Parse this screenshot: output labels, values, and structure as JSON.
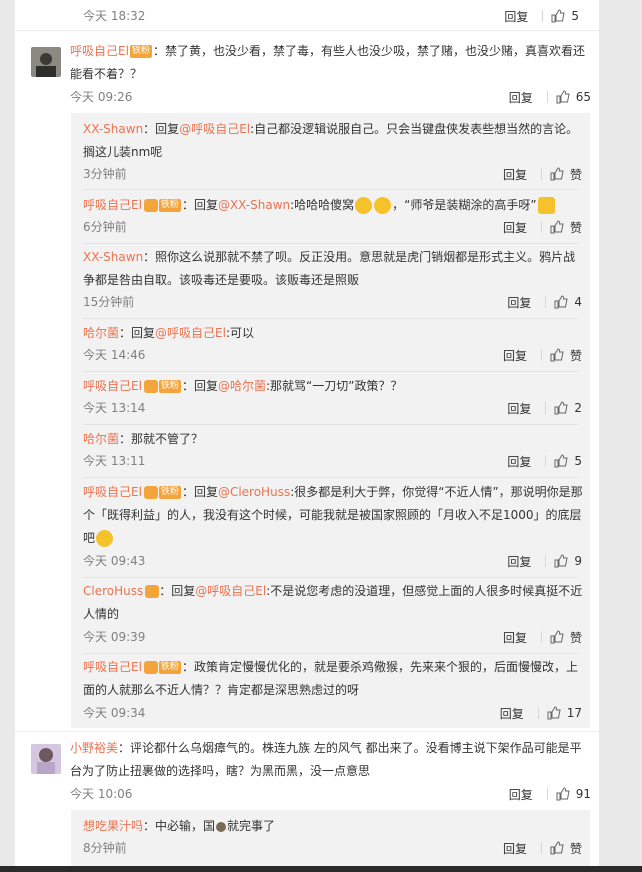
{
  "labels": {
    "reply": "回复",
    "like": "赞",
    "fan_badge": "铁粉"
  },
  "top_row": {
    "time": "今天 18:32",
    "likes": "5"
  },
  "comment1": {
    "user": "呼吸自己El",
    "text": "：禁了黄，也没少看，禁了毒，有些人也没少吸，禁了赌，也没少赌，真喜欢看还能看不着？？",
    "time": "今天 09:26",
    "likes": "65"
  },
  "replies": [
    {
      "user": "XX-Shawn",
      "pre": "：回复",
      "mention": "@呼吸自己El",
      "text": ":自己都没逻辑说服自己。只会当键盘侠发表些想当然的言论。搁这儿装nm呢",
      "time": "3分钟前"
    },
    {
      "user": "呼吸自己El",
      "pre": "：回复",
      "mention": "@XX-Shawn",
      "text": ":哈哈哈傻窝",
      "tail": "，“师爷是装糊涂的高手呀”",
      "time": "6分钟前"
    },
    {
      "user": "XX-Shawn",
      "text": "：照你这么说那就不禁了呗。反正没用。意思就是虎门销烟都是形式主义。鸦片战争都是咎由自取。该吸毒还是要吸。该贩毒还是照贩",
      "time": "15分钟前",
      "likes": "4"
    },
    {
      "user": "哈尔菌",
      "pre": "：回复",
      "mention": "@呼吸自己El",
      "text": ":可以",
      "time": "今天 14:46"
    },
    {
      "user": "呼吸自己El",
      "pre": "：回复",
      "mention": "@哈尔菌",
      "text": ":那就骂“一刀切”政策？？",
      "time": "今天 13:14",
      "likes": "2"
    },
    {
      "user": "哈尔菌",
      "text": "：那就不管了？",
      "time": "今天 13:11",
      "likes": "5"
    },
    {
      "user": "呼吸自己El",
      "pre": "：回复",
      "mention": "@CleroHuss",
      "text": ":很多都是利大于弊，你觉得“不近人情”，那说明你是那个「既得利益」的人，我没有这个时候，可能我就是被国家照顾的「月收入不足1000」的底层吧",
      "time": "今天 09:43",
      "likes": "9"
    },
    {
      "user": "CleroHuss",
      "pre": "：回复",
      "mention": "@呼吸自己El",
      "text": ":不是说您考虑的没道理，但感觉上面的人很多时候真挺不近人情的",
      "time": "今天 09:39"
    },
    {
      "user": "呼吸自己El",
      "text": "：政策肯定慢慢优化的，就是要杀鸡儆猴，先来来个狠的，后面慢慢改，上面的人就那么不近人情？？肯定都是深思熟虑过的呀",
      "time": "今天 09:34",
      "likes": "17"
    }
  ],
  "comment2": {
    "user": "小野裕美",
    "text": "：评论都什么乌烟瘴气的。株连九族 左的风气 都出来了。没看博主说下架作品可能是平台为了防止扭裹做的选择吗，瞎？为黑而黑，没一点意思",
    "time": "今天 10:06",
    "likes": "91"
  },
  "comment2_replies": [
    {
      "user": "想吃果汁吗",
      "text": "：中必输，国",
      "tail": "就完事了",
      "time": "8分钟前"
    }
  ]
}
